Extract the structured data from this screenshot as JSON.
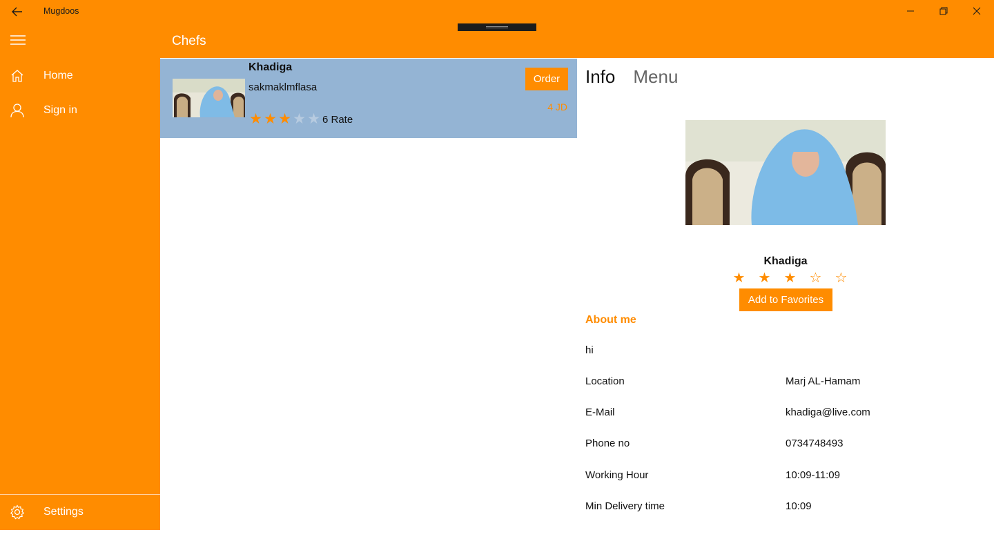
{
  "app": {
    "title": "Mugdoos"
  },
  "header": {
    "title": "Chefs"
  },
  "sidebar": {
    "items": [
      {
        "label": "Home",
        "icon": "home-icon"
      },
      {
        "label": "Sign in",
        "icon": "user-icon"
      }
    ],
    "settings": {
      "label": "Settings",
      "icon": "gear-icon"
    }
  },
  "chef_list": [
    {
      "name": "Khadiga",
      "description": "sakmaklmflasa",
      "rating": 3,
      "rating_max": 5,
      "rate_text": "6 Rate",
      "order_label": "Order",
      "price": "4 JD"
    }
  ],
  "detail": {
    "tabs": [
      "Info",
      "Menu"
    ],
    "active_tab": "Info",
    "name": "Khadiga",
    "rating": 3,
    "rating_max": 5,
    "favorite_label": "Add to Favorites",
    "about_title": "About me",
    "about_text": "hi",
    "fields": [
      {
        "label": "Location",
        "value": "Marj AL-Hamam"
      },
      {
        "label": "E-Mail",
        "value": "khadiga@live.com"
      },
      {
        "label": "Phone no",
        "value": "0734748493"
      },
      {
        "label": "Working Hour",
        "value": "10:09-11:09"
      },
      {
        "label": "Min Delivery time",
        "value": "10:09"
      }
    ]
  },
  "colors": {
    "accent": "#ff8c00",
    "selected_row": "#94b4d4",
    "text": "#111111"
  }
}
